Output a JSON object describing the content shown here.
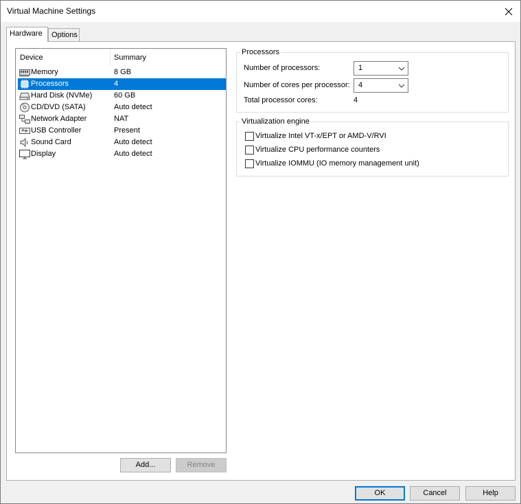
{
  "window": {
    "title": "Virtual Machine Settings"
  },
  "tabs": [
    {
      "label": "Hardware",
      "active": true
    },
    {
      "label": "Options",
      "active": false
    }
  ],
  "device_list": {
    "columns": {
      "device": "Device",
      "summary": "Summary"
    },
    "items": [
      {
        "icon": "memory-icon",
        "name": "Memory",
        "summary": "8 GB",
        "selected": false
      },
      {
        "icon": "processor-icon",
        "name": "Processors",
        "summary": "4",
        "selected": true
      },
      {
        "icon": "hard-disk-icon",
        "name": "Hard Disk (NVMe)",
        "summary": "60 GB",
        "selected": false
      },
      {
        "icon": "cd-dvd-icon",
        "name": "CD/DVD (SATA)",
        "summary": "Auto detect",
        "selected": false
      },
      {
        "icon": "network-adapter-icon",
        "name": "Network Adapter",
        "summary": "NAT",
        "selected": false
      },
      {
        "icon": "usb-icon",
        "name": "USB Controller",
        "summary": "Present",
        "selected": false
      },
      {
        "icon": "sound-card-icon",
        "name": "Sound Card",
        "summary": "Auto detect",
        "selected": false
      },
      {
        "icon": "display-icon",
        "name": "Display",
        "summary": "Auto detect",
        "selected": false
      }
    ],
    "add_label": "Add...",
    "remove_label": "Remove"
  },
  "processors": {
    "group_title": "Processors",
    "num_processors_label": "Number of processors:",
    "num_processors_value": "1",
    "cores_label": "Number of cores per processor:",
    "cores_value": "4",
    "total_label": "Total processor cores:",
    "total_value": "4"
  },
  "virtualization": {
    "group_title": "Virtualization engine",
    "options": [
      {
        "label": "Virtualize Intel VT-x/EPT or AMD-V/RVI",
        "checked": false
      },
      {
        "label": "Virtualize CPU performance counters",
        "checked": false
      },
      {
        "label": "Virtualize IOMMU (IO memory management unit)",
        "checked": false
      }
    ]
  },
  "footer": {
    "ok_label": "OK",
    "cancel_label": "Cancel",
    "help_label": "Help"
  },
  "colors": {
    "selection": "#0078d7",
    "default_button_border": "#0078d7"
  }
}
